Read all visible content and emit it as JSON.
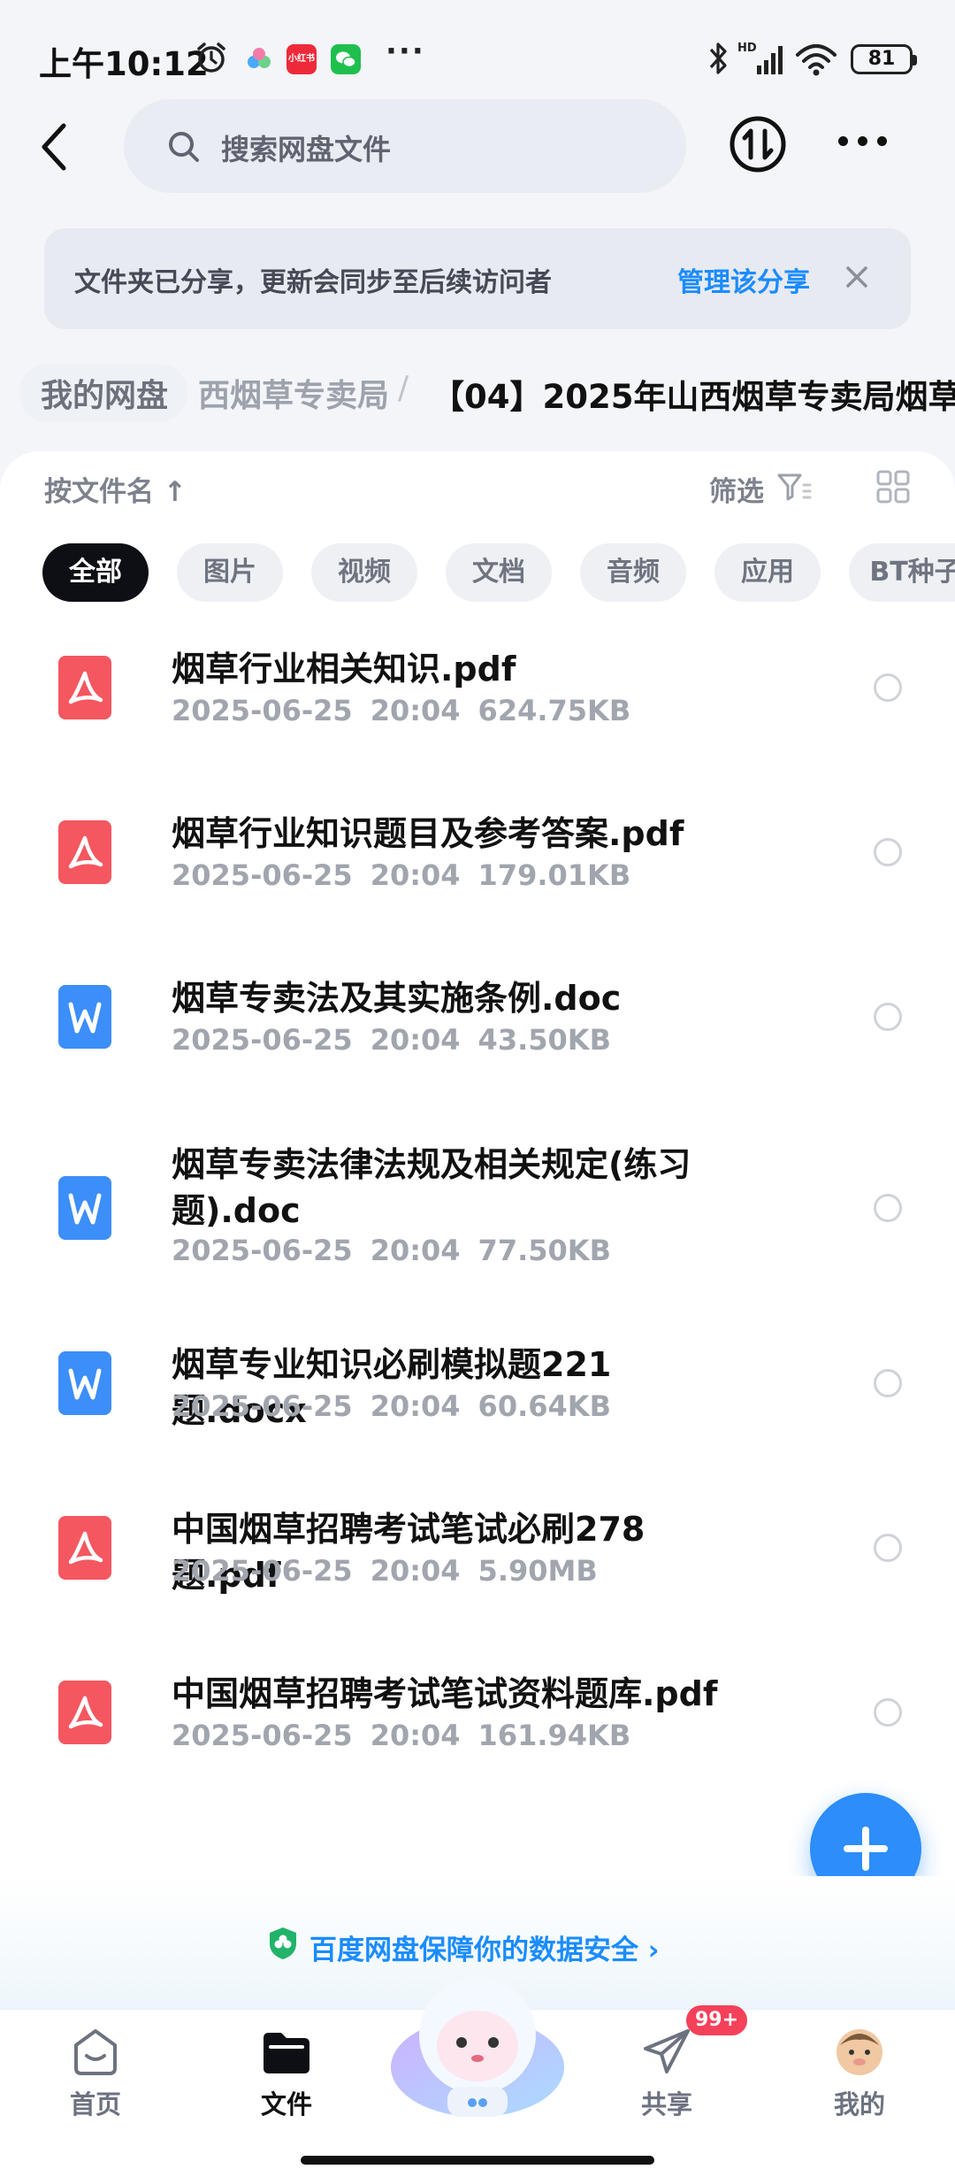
{
  "status_bar": {
    "time": "上午10:12",
    "battery": "81",
    "app_badge_text": "小红书",
    "more": "···"
  },
  "header": {
    "search_placeholder": "搜索网盘文件"
  },
  "banner": {
    "text": "文件夹已分享，更新会同步至后续访问者",
    "link": "管理该分享"
  },
  "breadcrumb": {
    "root": "我的网盘",
    "middle": "西烟草专卖局",
    "separator": "/",
    "current": "【04】2025年山西烟草专卖局烟草"
  },
  "toolbar": {
    "sort_label": "按文件名 ↑",
    "filter_label": "筛选"
  },
  "chips": [
    "全部",
    "图片",
    "视频",
    "文档",
    "音频",
    "应用",
    "BT种子"
  ],
  "files": [
    {
      "name": "烟草行业相关知识.pdf",
      "date": "2025-06-25",
      "time": "20:04",
      "size": "624.75KB",
      "type": "pdf"
    },
    {
      "name": "烟草行业知识题目及参考答案.pdf",
      "date": "2025-06-25",
      "time": "20:04",
      "size": "179.01KB",
      "type": "pdf"
    },
    {
      "name": "烟草专卖法及其实施条例.doc",
      "date": "2025-06-25",
      "time": "20:04",
      "size": "43.50KB",
      "type": "doc"
    },
    {
      "name": "烟草专卖法律法规及相关规定(练习题).doc",
      "date": "2025-06-25",
      "time": "20:04",
      "size": "77.50KB",
      "type": "doc"
    },
    {
      "name": "烟草专业知识必刷模拟题221题.docx",
      "date": "2025-06-25",
      "time": "20:04",
      "size": "60.64KB",
      "type": "doc"
    },
    {
      "name": "中国烟草招聘考试笔试必刷278题.pdf",
      "date": "2025-06-25",
      "time": "20:04",
      "size": "5.90MB",
      "type": "pdf"
    },
    {
      "name": "中国烟草招聘考试笔试资料题库.pdf",
      "date": "2025-06-25",
      "time": "20:04",
      "size": "161.94KB",
      "type": "pdf"
    }
  ],
  "safety": {
    "text": "百度网盘保障你的数据安全 ›"
  },
  "tabbar": {
    "home": "首页",
    "files": "文件",
    "share": "共享",
    "share_badge": "99+",
    "mine": "我的"
  },
  "colors": {
    "accent": "#1a8cff",
    "pdf": "#f4575f",
    "doc": "#3c8ef9",
    "badge": "#f5405a"
  }
}
